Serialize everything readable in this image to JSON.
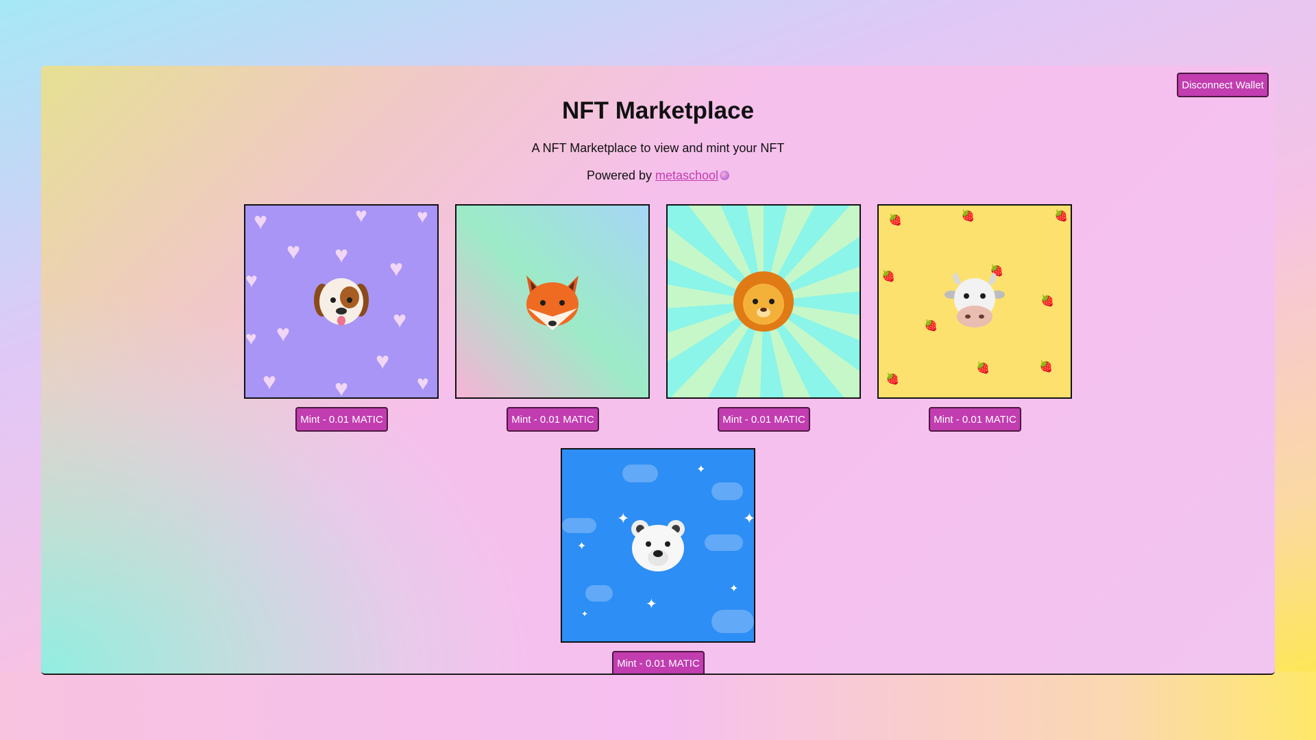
{
  "header": {
    "disconnect_label": "Disconnect Wallet",
    "title": "NFT Marketplace",
    "subtitle": "A NFT Marketplace to view and mint your NFT",
    "powered_prefix": "Powered by ",
    "powered_link": "metaschool"
  },
  "nfts": [
    {
      "animal": "dog",
      "background": "hearts",
      "mint_label": "Mint - 0.01 MATIC"
    },
    {
      "animal": "fox",
      "background": "gradient",
      "mint_label": "Mint - 0.01 MATIC"
    },
    {
      "animal": "lion",
      "background": "sunburst",
      "mint_label": "Mint - 0.01 MATIC"
    },
    {
      "animal": "cow",
      "background": "strawberries",
      "mint_label": "Mint - 0.01 MATIC"
    },
    {
      "animal": "polar-bear",
      "background": "sky",
      "mint_label": "Mint - 0.01 MATIC"
    }
  ],
  "colors": {
    "button": "#c13db0",
    "link": "#c13db0"
  }
}
